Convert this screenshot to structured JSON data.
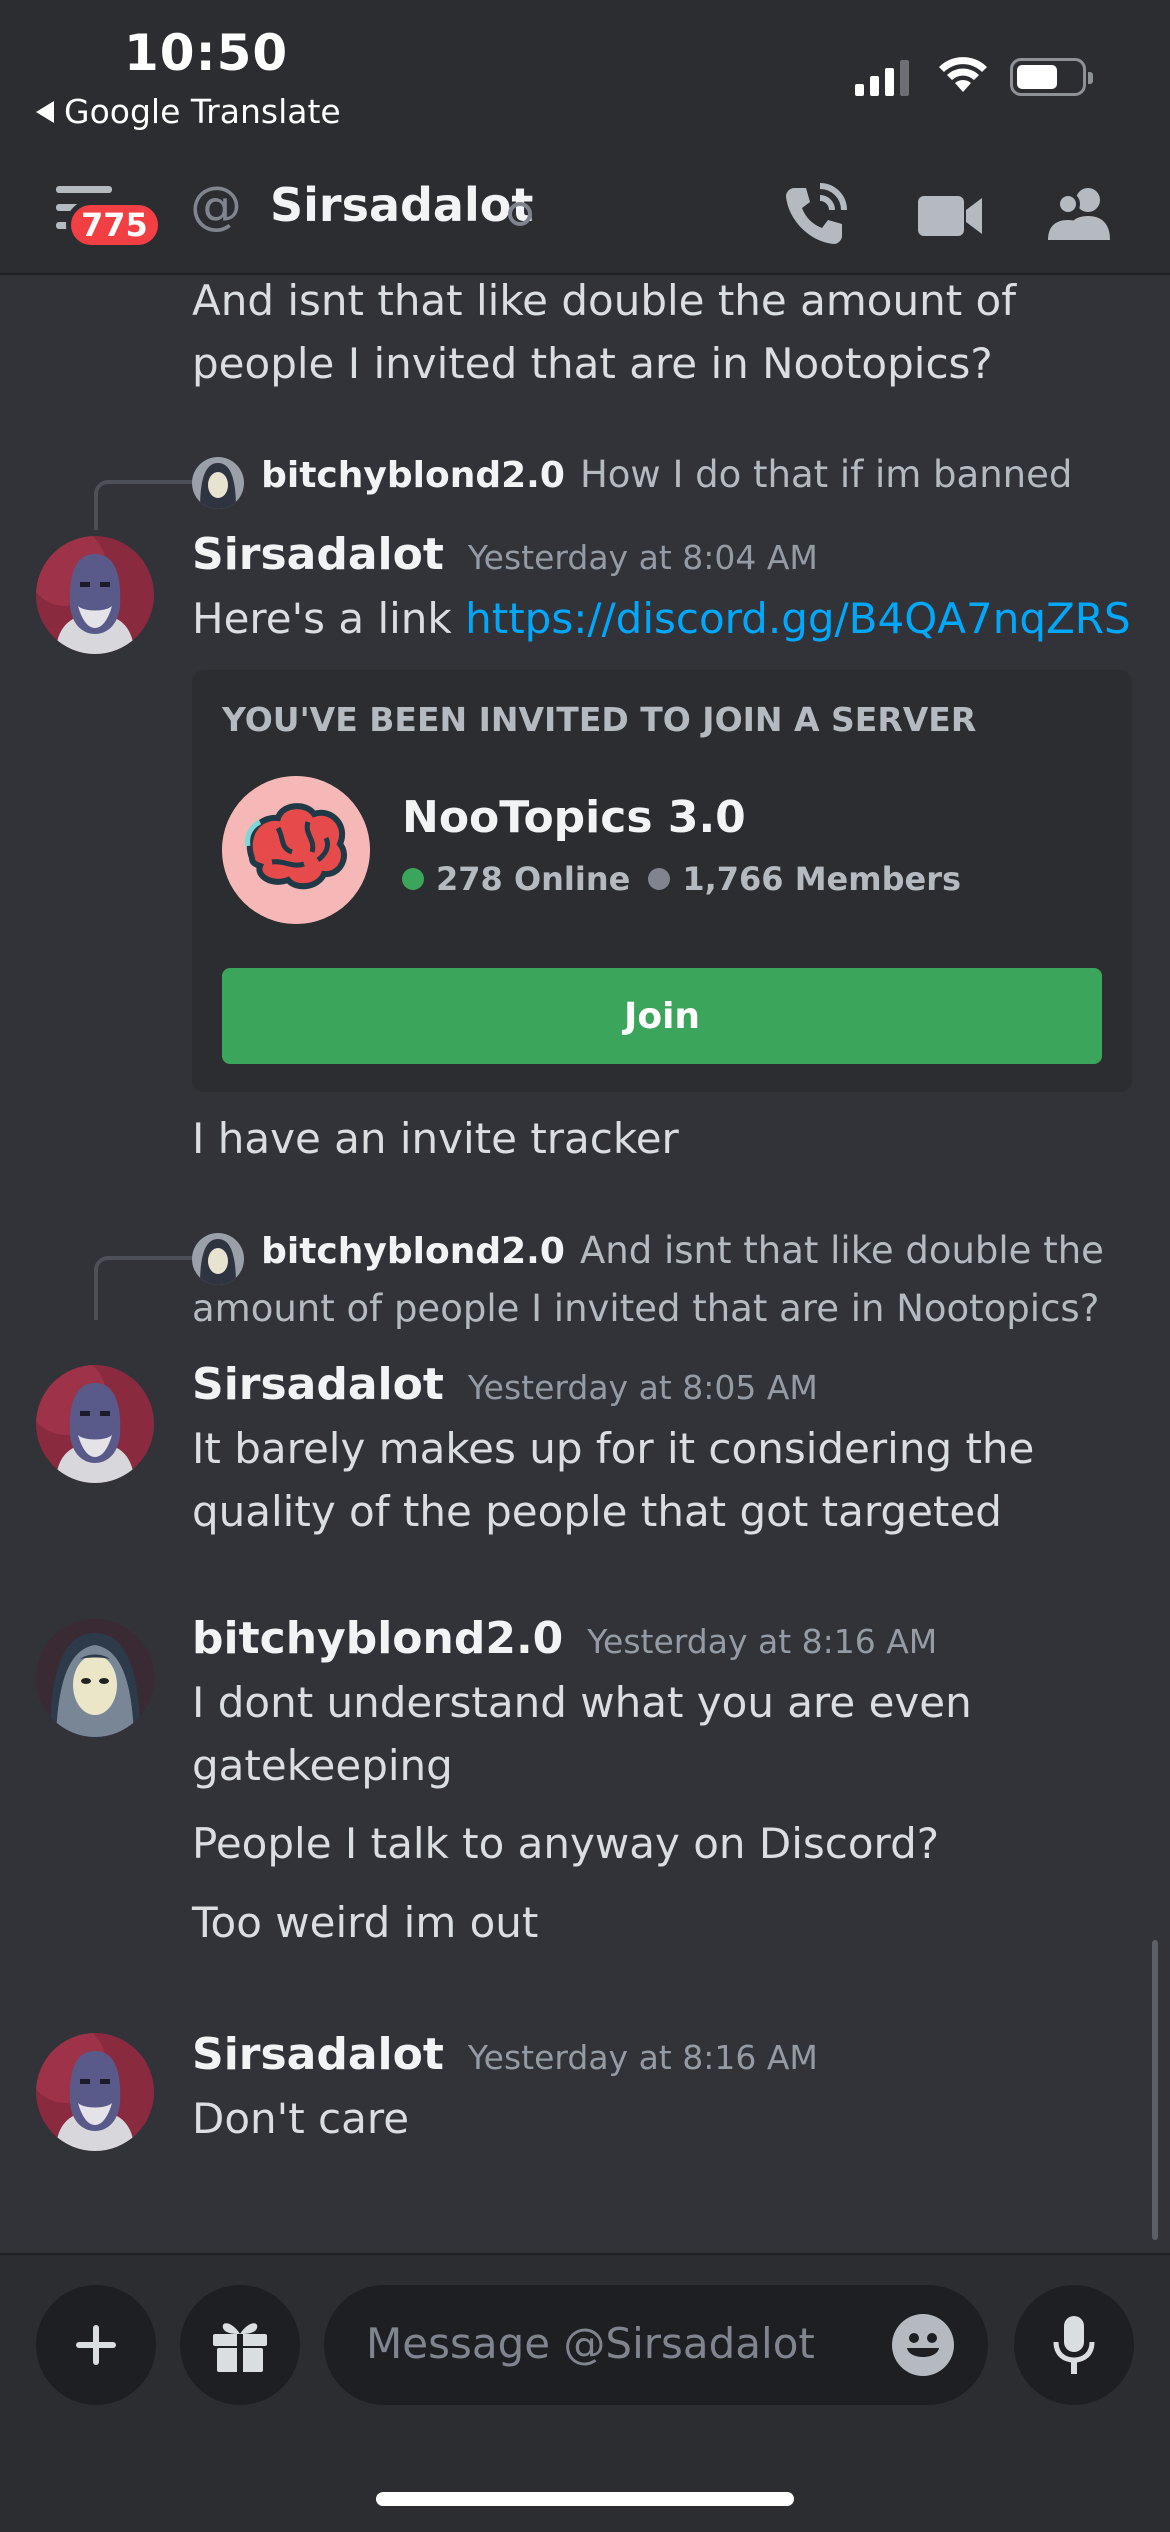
{
  "status_bar": {
    "time": "10:50",
    "back_app": "Google Translate"
  },
  "header": {
    "unread_badge": "775",
    "dm_name": "Sirsadalot"
  },
  "messages": {
    "prev_text": "And isnt that like double the amount of people I invited that are in Nootopics?",
    "m1": {
      "reply_name": "bitchyblond2.0",
      "reply_text": "How I do that if im banned",
      "author": "Sirsadalot",
      "time": "Yesterday at 8:04 AM",
      "text_prefix": "Here's a link ",
      "link": "https://discord.gg/B4QA7nqZRS",
      "invite": {
        "header": "YOU'VE BEEN INVITED TO JOIN A SERVER",
        "server": "NooTopics 3.0",
        "online": "278 Online",
        "members": "1,766 Members",
        "join": "Join"
      },
      "followup": "I have an invite tracker"
    },
    "m2": {
      "reply_name": "bitchyblond2.0",
      "reply_text_1": "And isnt that like double the",
      "reply_text_2": "amount of people I invited that are in Nootopics?",
      "author": "Sirsadalot",
      "time": "Yesterday at 8:05 AM",
      "line1": "It barely makes up for it considering the",
      "line2": "quality of the people that got targeted"
    },
    "m3": {
      "author": "bitchyblond2.0",
      "time": "Yesterday at 8:16 AM",
      "line1": "I dont understand what you are even",
      "line2": "gatekeeping",
      "line3": "People I talk to anyway on Discord?",
      "line4": "Too weird im out"
    },
    "m4": {
      "author": "Sirsadalot",
      "time": "Yesterday at 8:16 AM",
      "text": "Don't care"
    }
  },
  "composer": {
    "placeholder": "Message @Sirsadalot"
  },
  "colors": {
    "online": "#3ba55c",
    "offline": "#80848e",
    "link": "#00a8fc",
    "badge": "#f23f43"
  }
}
